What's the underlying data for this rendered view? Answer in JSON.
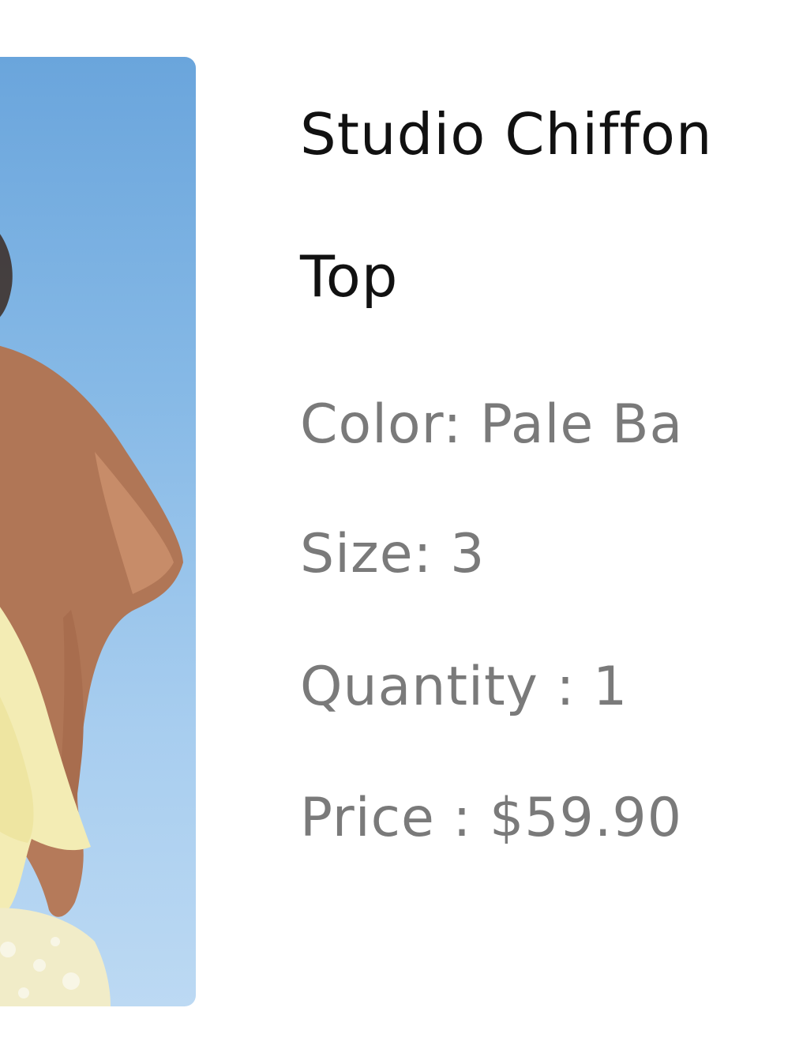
{
  "product": {
    "title_line_1": "Studio Chiffon",
    "title_line_2": "Top",
    "color_text": "Color: Pale Ba",
    "size_text": "Size: 3",
    "quantity_text": "Quantity : 1",
    "price_text": "Price : $59.90"
  },
  "colors": {
    "title": "#111111",
    "attribute_text": "#7a7a7a",
    "sky": "#86b9e6",
    "garment": "#f3ecb4"
  }
}
